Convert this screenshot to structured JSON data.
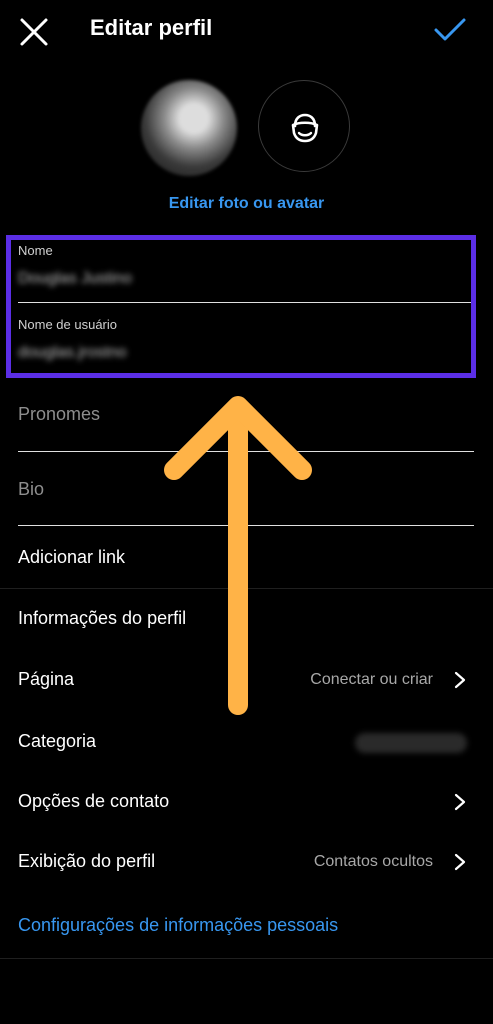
{
  "header": {
    "title": "Editar perfil"
  },
  "avatar": {
    "edit_link": "Editar foto ou avatar"
  },
  "fields": {
    "name": {
      "label": "Nome",
      "value": "Douglas Justino"
    },
    "username": {
      "label": "Nome de usuário",
      "value": "douglas.jrostno"
    },
    "pronouns": {
      "placeholder": "Pronomes"
    },
    "bio": {
      "placeholder": "Bio"
    }
  },
  "add_link": "Adicionar link",
  "profile_info": {
    "heading": "Informações do perfil",
    "rows": [
      {
        "label": "Página",
        "value": "Conectar ou criar"
      },
      {
        "label": "Categoria",
        "value": ""
      },
      {
        "label": "Opções de contato",
        "value": ""
      },
      {
        "label": "Exibição do perfil",
        "value": "Contatos ocultos"
      }
    ]
  },
  "personal_settings_link": "Configurações de informações pessoais",
  "colors": {
    "accent": "#3897f0",
    "highlight_box": "#5b2ee6",
    "overlay_arrow": "#ffb347",
    "background": "#000000"
  }
}
